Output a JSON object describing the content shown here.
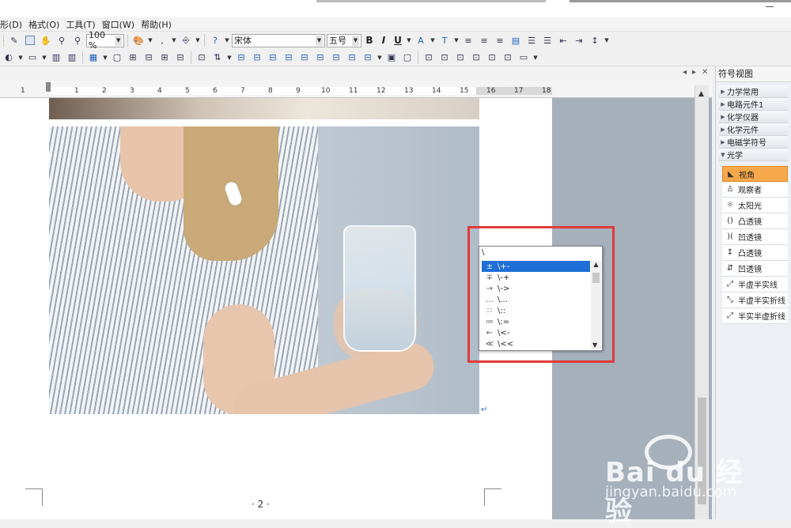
{
  "menu": [
    {
      "label": "形(D)"
    },
    {
      "label": "格式(O)"
    },
    {
      "label": "工具(T)"
    },
    {
      "label": "窗口(W)"
    },
    {
      "label": "帮助(H)"
    }
  ],
  "toolbar": {
    "zoom": "100 %",
    "font_name": "宋体",
    "font_size": "五号",
    "bold": "B",
    "italic": "I",
    "underline": "U"
  },
  "ruler": {
    "marks": [
      "1",
      "1",
      "2",
      "3",
      "4",
      "5",
      "6",
      "7",
      "8",
      "9",
      "10",
      "11",
      "12",
      "13",
      "14",
      "15",
      "16",
      "17",
      "18"
    ]
  },
  "document": {
    "page_number": "· 2 ·"
  },
  "autocomplete": {
    "input": "\\",
    "items": [
      {
        "sym": "±",
        "code": "\\+-"
      },
      {
        "sym": "∓",
        "code": "\\-+"
      },
      {
        "sym": "→",
        "code": "\\->"
      },
      {
        "sym": "…",
        "code": "\\..."
      },
      {
        "sym": "∷",
        "code": "\\::"
      },
      {
        "sym": "≔",
        "code": "\\:="
      },
      {
        "sym": "←",
        "code": "\\<-"
      },
      {
        "sym": "≪",
        "code": "\\<<"
      }
    ],
    "selected_index": 0
  },
  "symbol_panel": {
    "title": "符号视图",
    "categories": [
      {
        "label": "力学常用"
      },
      {
        "label": "电路元件1"
      },
      {
        "label": "化学仪器"
      },
      {
        "label": "化学元件"
      },
      {
        "label": "电磁学符号"
      },
      {
        "label": "光学"
      }
    ],
    "items": [
      {
        "label": "视角"
      },
      {
        "label": "观察者"
      },
      {
        "label": "太阳光"
      },
      {
        "label": "凸透镜"
      },
      {
        "label": "凹透镜"
      },
      {
        "label": "凸透镜"
      },
      {
        "label": "凹透镜"
      },
      {
        "label": "半虚半实线"
      },
      {
        "label": "半虚半实折线"
      },
      {
        "label": "半实半虚折线"
      }
    ]
  },
  "watermark": {
    "brand": "Bai du 经验",
    "url": "jingyan.baidu.com"
  },
  "colors": {
    "accent_selection": "#1f6fd6",
    "highlight_box": "#e03a3a",
    "panel_selected": "#f7a84a"
  }
}
